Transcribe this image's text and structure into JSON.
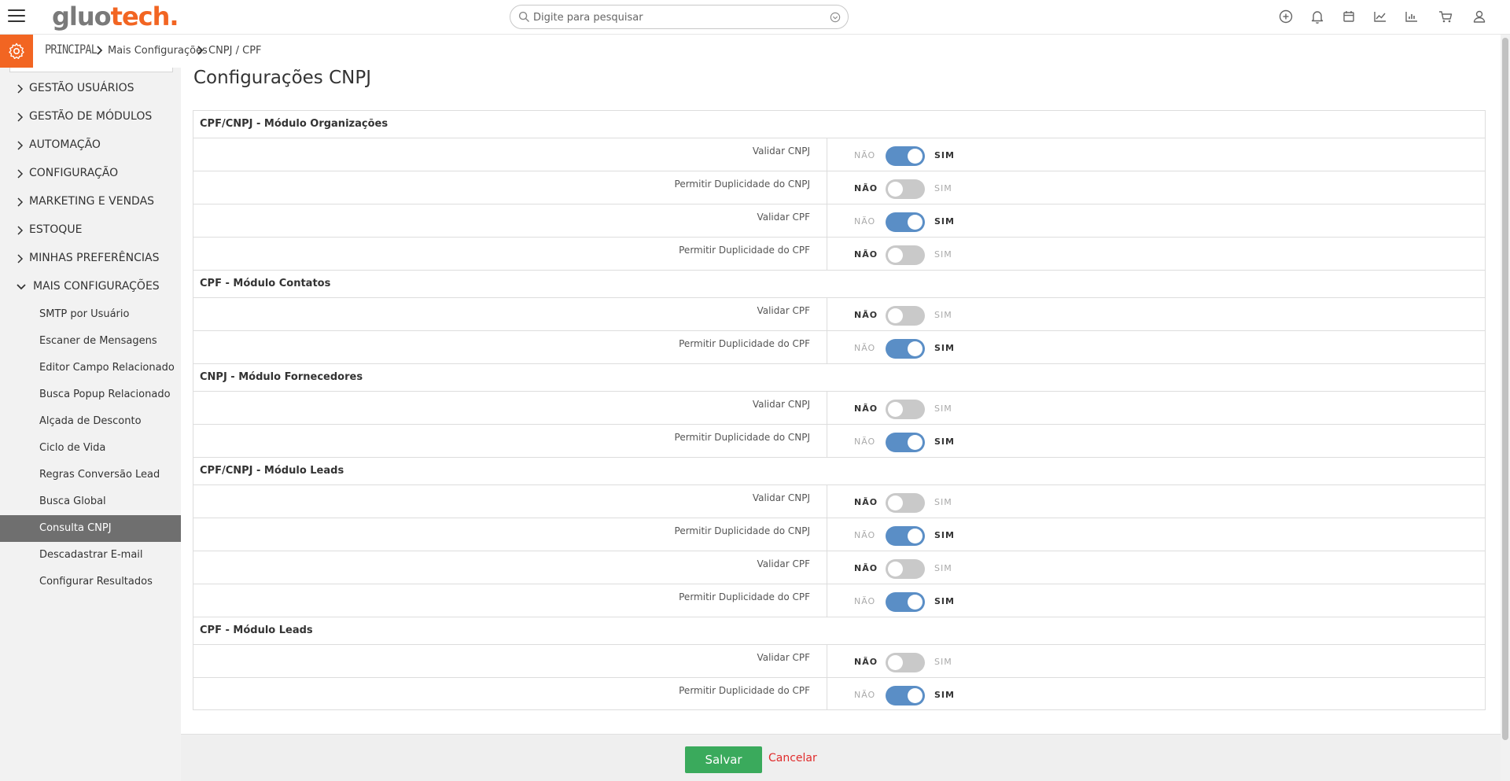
{
  "header": {
    "logo_part1": "gluo",
    "logo_part2": "tech.",
    "search_placeholder": "Digite para pesquisar",
    "icons": [
      "plus-circle-icon",
      "bell-icon",
      "calendar-icon",
      "line-chart-icon",
      "bar-chart-icon",
      "cart-icon",
      "user-icon"
    ]
  },
  "breadcrumb": {
    "main": "PRINCIPAL",
    "level2": "Mais Configurações",
    "level3": "CNPJ / CPF"
  },
  "sidebar": {
    "groups": [
      {
        "label": "GESTÃO USUÁRIOS",
        "expanded": false
      },
      {
        "label": "GESTÃO DE MÓDULOS",
        "expanded": false
      },
      {
        "label": "AUTOMAÇÃO",
        "expanded": false
      },
      {
        "label": "CONFIGURAÇÃO",
        "expanded": false
      },
      {
        "label": "MARKETING E VENDAS",
        "expanded": false
      },
      {
        "label": "ESTOQUE",
        "expanded": false
      },
      {
        "label": "MINHAS PREFERÊNCIAS",
        "expanded": false
      },
      {
        "label": "MAIS CONFIGURAÇÕES",
        "expanded": true
      }
    ],
    "items": [
      {
        "label": "SMTP por Usuário"
      },
      {
        "label": "Escaner de Mensagens"
      },
      {
        "label": "Editor Campo Relacionado"
      },
      {
        "label": "Busca Popup Relacionado"
      },
      {
        "label": "Alçada de Desconto"
      },
      {
        "label": "Ciclo de Vida"
      },
      {
        "label": "Regras Conversão Lead"
      },
      {
        "label": "Busca Global"
      },
      {
        "label": "Consulta CNPJ",
        "active": true
      },
      {
        "label": "Descadastrar E-mail"
      },
      {
        "label": "Configurar Resultados"
      }
    ]
  },
  "page": {
    "title": "Configurações CNPJ",
    "no_label": "NÃO",
    "yes_label": "SIM"
  },
  "sections": [
    {
      "title": "CPF/CNPJ - Módulo Organizações",
      "rows": [
        {
          "label": "Validar CNPJ",
          "enabled": true
        },
        {
          "label": "Permitir Duplicidade do CNPJ",
          "enabled": false
        },
        {
          "label": "Validar CPF",
          "enabled": true
        },
        {
          "label": "Permitir Duplicidade do CPF",
          "enabled": false
        }
      ]
    },
    {
      "title": "CPF - Módulo Contatos",
      "rows": [
        {
          "label": "Validar CPF",
          "enabled": false
        },
        {
          "label": "Permitir Duplicidade do CPF",
          "enabled": true
        }
      ]
    },
    {
      "title": "CNPJ - Módulo Fornecedores",
      "rows": [
        {
          "label": "Validar CNPJ",
          "enabled": false
        },
        {
          "label": "Permitir Duplicidade do CNPJ",
          "enabled": true
        }
      ]
    },
    {
      "title": "CPF/CNPJ - Módulo Leads",
      "rows": [
        {
          "label": "Validar CNPJ",
          "enabled": false
        },
        {
          "label": "Permitir Duplicidade do CNPJ",
          "enabled": true
        },
        {
          "label": "Validar CPF",
          "enabled": false
        },
        {
          "label": "Permitir Duplicidade do CPF",
          "enabled": true
        }
      ]
    },
    {
      "title": "CPF - Módulo Leads",
      "rows": [
        {
          "label": "Validar CPF",
          "enabled": false
        },
        {
          "label": "Permitir Duplicidade do CPF",
          "enabled": true
        }
      ]
    }
  ],
  "footer": {
    "save_label": "Salvar",
    "cancel_label": "Cancelar"
  },
  "colors": {
    "brand_orange": "#f26522",
    "toggle_on": "#5a8ec6",
    "toggle_off": "#c9c9c9",
    "save_green": "#3aaa5c",
    "cancel_red": "#e02c2c"
  }
}
